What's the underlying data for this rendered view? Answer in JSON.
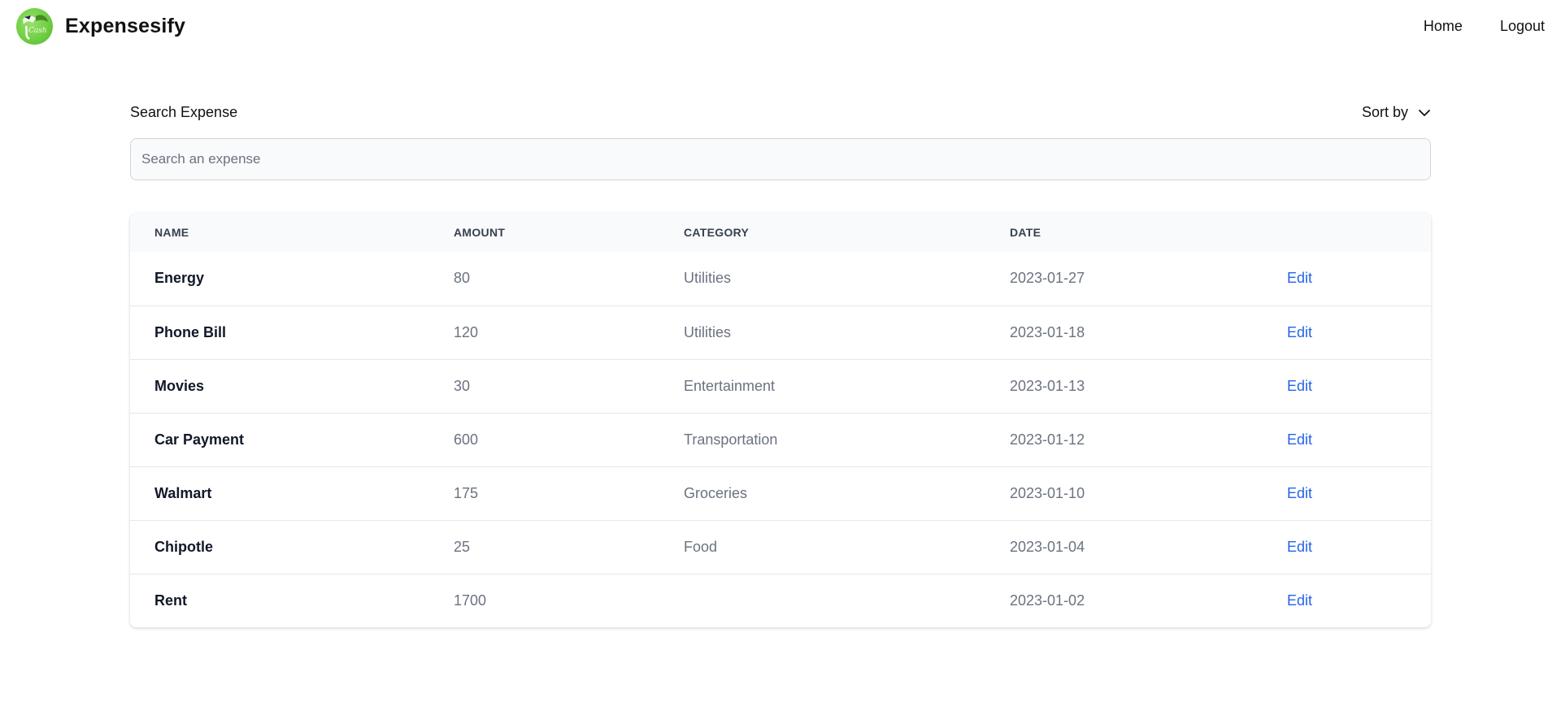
{
  "header": {
    "brand": "Expensesify",
    "nav": [
      "Home",
      "Logout"
    ]
  },
  "search": {
    "label": "Search Expense",
    "placeholder": "Search an expense",
    "value": "",
    "sort_label": "Sort by"
  },
  "table": {
    "columns": [
      "NAME",
      "AMOUNT",
      "CATEGORY",
      "DATE"
    ],
    "rows": [
      {
        "name": "Energy",
        "amount": "80",
        "category": "Utilities",
        "date": "2023-01-27",
        "action": "Edit"
      },
      {
        "name": "Phone Bill",
        "amount": "120",
        "category": "Utilities",
        "date": "2023-01-18",
        "action": "Edit"
      },
      {
        "name": "Movies",
        "amount": "30",
        "category": "Entertainment",
        "date": "2023-01-13",
        "action": "Edit"
      },
      {
        "name": "Car Payment",
        "amount": "600",
        "category": "Transportation",
        "date": "2023-01-12",
        "action": "Edit"
      },
      {
        "name": "Walmart",
        "amount": "175",
        "category": "Groceries",
        "date": "2023-01-10",
        "action": "Edit"
      },
      {
        "name": "Chipotle",
        "amount": "25",
        "category": "Food",
        "date": "2023-01-04",
        "action": "Edit"
      },
      {
        "name": "Rent",
        "amount": "1700",
        "category": "",
        "date": "2023-01-02",
        "action": "Edit"
      }
    ]
  },
  "colors": {
    "link": "#2563eb",
    "logo": "#6fcf44",
    "header_bg": "#f9fafb"
  },
  "icons": {
    "logo": "expensesify-logo-icon",
    "sort": "chevron-down-icon"
  }
}
